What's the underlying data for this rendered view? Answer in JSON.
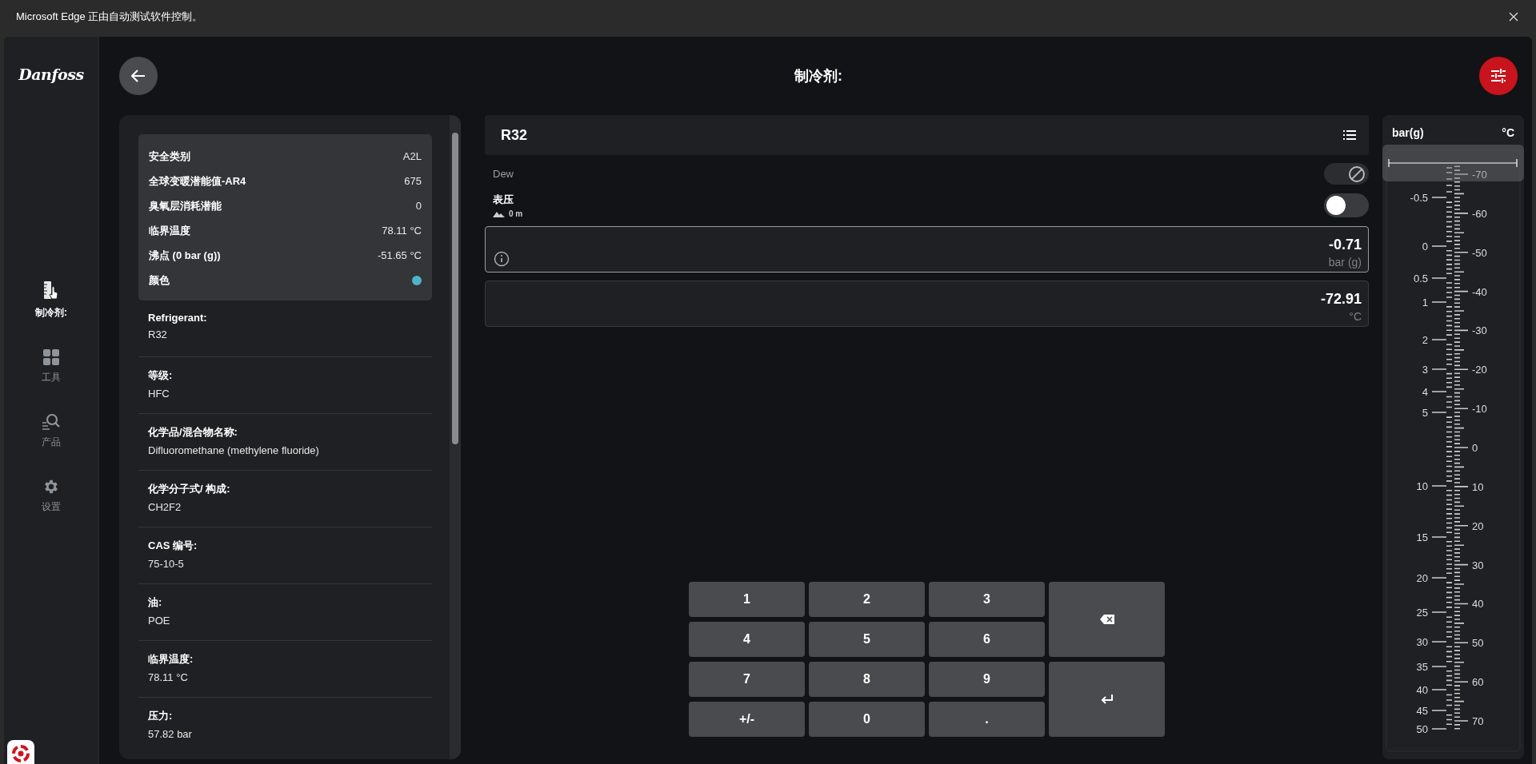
{
  "banner": {
    "text": "Microsoft Edge 正由自动测试软件控制。"
  },
  "logo": "Danfoss",
  "nav": [
    {
      "label": "制冷剂:",
      "kind": "ruler",
      "selected": true
    },
    {
      "label": "工具",
      "kind": "grid",
      "selected": false
    },
    {
      "label": "产品",
      "kind": "search",
      "selected": false
    },
    {
      "label": "设置",
      "kind": "gear",
      "selected": false
    }
  ],
  "header": {
    "title": "制冷剂:"
  },
  "summary": [
    {
      "label": "安全类别",
      "value": "A2L"
    },
    {
      "label": "全球变暖潜能值-AR4",
      "value": "675"
    },
    {
      "label": "臭氧层消耗潜能",
      "value": "0"
    },
    {
      "label": "临界温度",
      "value": "78.11 °C"
    },
    {
      "label": "沸点 (0 bar (g))",
      "value": "-51.65 °C"
    },
    {
      "label": "颜色",
      "color": "#4fb3c8"
    }
  ],
  "details": [
    {
      "label": "Refrigerant:",
      "value": "R32"
    },
    {
      "label": "等级:",
      "value": "HFC"
    },
    {
      "label": "化学品/混合物名称:",
      "value": "Difluoromethane (methylene fluoride)"
    },
    {
      "label": "化学分子式/ 构成:",
      "value": "CH2F2"
    },
    {
      "label": "CAS 编号:",
      "value": "75-10-5"
    },
    {
      "label": "油:",
      "value": "POE"
    },
    {
      "label": "临界温度:",
      "value": "78.11 °C"
    },
    {
      "label": "压力:",
      "value": "57.82 bar"
    }
  ],
  "refrigerant_select": {
    "value": "R32"
  },
  "dew": {
    "label": "Dew",
    "disabled": true
  },
  "gauge": {
    "label": "表压",
    "altitude": "0 m",
    "on": false
  },
  "readings": [
    {
      "value": "-0.71",
      "unit": "bar (g)",
      "selected": true,
      "info": true
    },
    {
      "value": "-72.91",
      "unit": "°C",
      "selected": false,
      "info": false
    }
  ],
  "keypad": {
    "keys": [
      {
        "kind": "digit",
        "label": "1"
      },
      {
        "kind": "digit",
        "label": "2"
      },
      {
        "kind": "digit",
        "label": "3"
      },
      {
        "kind": "backspace"
      },
      {
        "kind": "digit",
        "label": "4"
      },
      {
        "kind": "digit",
        "label": "5"
      },
      {
        "kind": "digit",
        "label": "6"
      },
      {
        "kind": "digit",
        "label": "7"
      },
      {
        "kind": "digit",
        "label": "8"
      },
      {
        "kind": "digit",
        "label": "9"
      },
      {
        "kind": "enter"
      },
      {
        "kind": "digit",
        "label": "+/-"
      },
      {
        "kind": "digit",
        "label": "0"
      },
      {
        "kind": "digit",
        "label": "."
      }
    ]
  },
  "scale": {
    "left_unit": "bar(g)",
    "right_unit": "°C",
    "pressure_labels": [
      "-0.5",
      "0",
      "0.5",
      "1",
      "2",
      "3",
      "4",
      "5",
      "10",
      "15",
      "20",
      "25",
      "30",
      "35",
      "40",
      "45",
      "50"
    ],
    "temperature_labels": [
      "-70",
      "-60",
      "-50",
      "-40",
      "-30",
      "-20",
      "-10",
      "0",
      "10",
      "20",
      "30",
      "40",
      "50",
      "60",
      "70"
    ]
  }
}
